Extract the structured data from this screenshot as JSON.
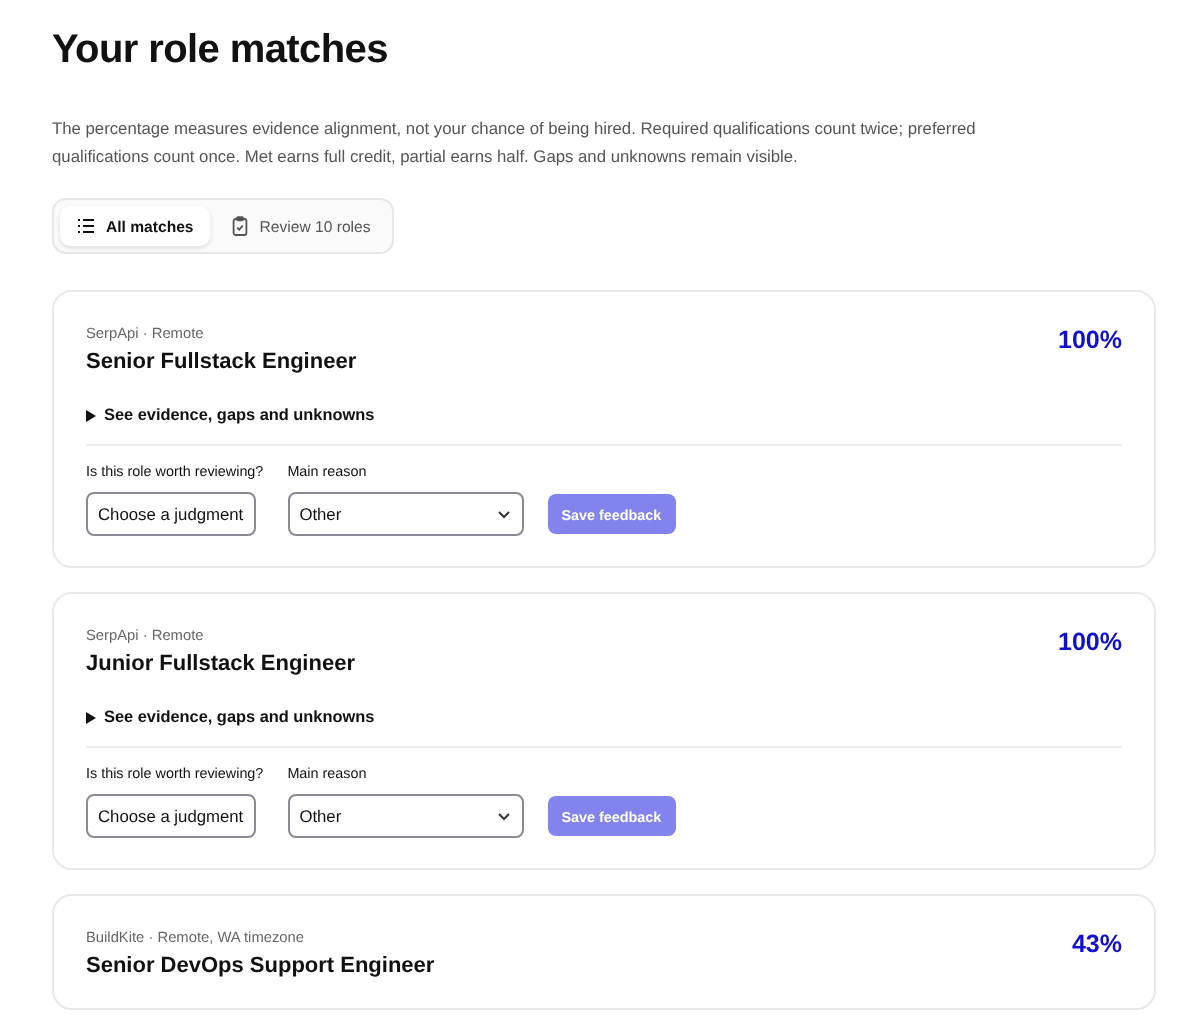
{
  "title": "Your role matches",
  "description": "The percentage measures evidence alignment, not your chance of being hired. Required qualifications count twice; preferred qualifications count once. Met earns full credit, partial earns half. Gaps and unknowns remain visible.",
  "tabs": [
    {
      "label": "All matches",
      "selected": true,
      "kind": "list"
    },
    {
      "label": "Review 10 roles",
      "selected": false,
      "kind": "clipboard"
    }
  ],
  "roles": [
    {
      "meta": "SerpApi · Remote",
      "title": "Senior Fullstack Engineer",
      "score": "100%",
      "details": {
        "label": "See evidence, gaps and unknowns",
        "expanded": false
      },
      "feedback": {
        "judgment_label": "Is this role worth reviewing?",
        "judgment_value": "Choose a judgment",
        "reason_label": "Main reason",
        "reason_value": "Other",
        "save_label": "Save feedback",
        "save_disabled": true
      }
    },
    {
      "meta": "SerpApi · Remote",
      "title": "Junior Fullstack Engineer",
      "score": "100%",
      "details": {
        "label": "See evidence, gaps and unknowns",
        "expanded": false
      },
      "feedback": {
        "judgment_label": "Is this role worth reviewing?",
        "judgment_value": "Choose a judgment",
        "reason_label": "Main reason",
        "reason_value": "Other",
        "save_label": "Save feedback",
        "save_disabled": true
      }
    },
    {
      "meta": "BuildKite · Remote, WA timezone",
      "title": "Senior DevOps Support Engineer",
      "score": "43%"
    }
  ]
}
